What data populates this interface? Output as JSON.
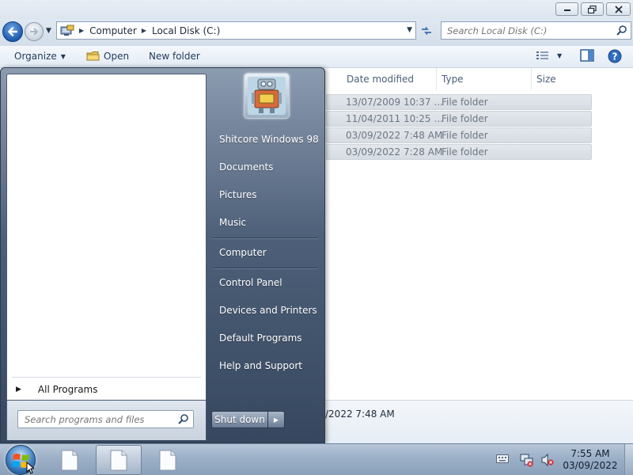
{
  "explorer": {
    "address": {
      "crumbs": [
        "Computer",
        "Local Disk (C:)"
      ]
    },
    "search": {
      "placeholder": "Search Local Disk (C:)"
    },
    "toolbar": {
      "organize_label": "Organize",
      "open_label": "Open",
      "new_folder_label": "New folder"
    },
    "columns": {
      "date": "Date modified",
      "type": "Type",
      "size": "Size"
    },
    "files": [
      {
        "date": "13/07/2009 10:37 ...",
        "type": "File folder"
      },
      {
        "date": "11/04/2011 10:25 ...",
        "type": "File folder"
      },
      {
        "date": "03/09/2022 7:48 AM",
        "type": "File folder"
      },
      {
        "date": "03/09/2022 7:28 AM",
        "type": "File folder"
      }
    ],
    "details": {
      "date_fragment": "/2022 7:48 AM"
    }
  },
  "start_menu": {
    "all_programs_label": "All Programs",
    "search_placeholder": "Search programs and files",
    "right_links": [
      "Shitcore Windows 98",
      "Documents",
      "Pictures",
      "Music",
      "Computer",
      "Control Panel",
      "Devices and Printers",
      "Default Programs",
      "Help and Support"
    ],
    "shutdown_label": "Shut down"
  },
  "taskbar": {
    "clock": {
      "time": "7:55 AM",
      "date": "03/09/2022"
    }
  },
  "icons": {
    "caption_min": "minimize-icon",
    "caption_max": "restore-icon",
    "caption_close": "close-icon",
    "back": "back-arrow-icon",
    "forward": "forward-arrow-icon",
    "refresh": "refresh-icon",
    "search": "search-icon",
    "open": "folder-icon",
    "views": "views-icon",
    "preview": "preview-pane-icon",
    "help": "help-icon",
    "start": "windows-logo-icon",
    "tray": [
      "keyboard-icon",
      "network-icon",
      "volume-muted-icon"
    ]
  }
}
